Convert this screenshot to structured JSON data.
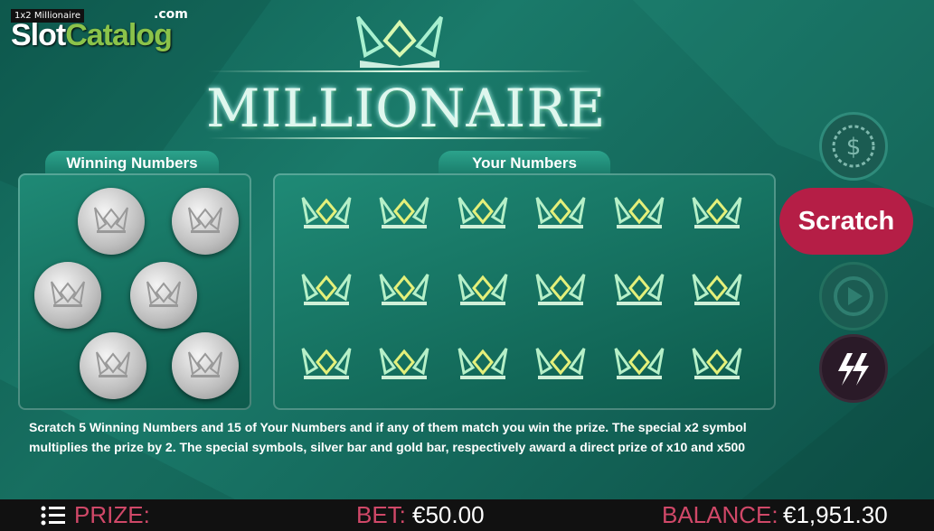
{
  "brand": {
    "overlay_text": "1x2 Millionaire",
    "slot": "Slot",
    "catalog": "Catalog",
    "com": ".com"
  },
  "title": "MILLIONAIRE",
  "panels": {
    "winning_label": "Winning Numbers",
    "your_label": "Your Numbers"
  },
  "description": "Scratch 5 Winning Numbers and 15 of Your Numbers and if any of them match you win the prize. The special x2 symbol multiplies the prize by 2. The special symbols, silver bar and gold bar, respectively award a direct prize of x10 and x500",
  "buttons": {
    "scratch": "Scratch",
    "coin_icon": "dollar-coin-icon",
    "autoplay_icon": "autoplay-icon",
    "turbo_icon": "lightning-icon"
  },
  "bottombar": {
    "prize_label": "PRIZE:",
    "prize_value": "",
    "bet_label": "BET:",
    "bet_value": "€50.00",
    "balance_label": "BALANCE:",
    "balance_value": "€1,951.30"
  },
  "colors": {
    "accent": "#b51e46",
    "label": "#d04868",
    "background": "#157060"
  }
}
